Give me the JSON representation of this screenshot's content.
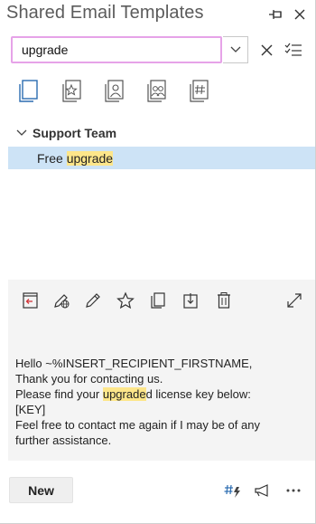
{
  "app": {
    "title": "Shared Email Templates"
  },
  "header": {
    "pin_icon": "pin-icon",
    "close_icon": "close-icon"
  },
  "search": {
    "value": "upgrade",
    "placeholder": ""
  },
  "tabs": [
    {
      "name": "templates",
      "icon": "template-icon",
      "active": true
    },
    {
      "name": "favorites",
      "icon": "star-page-icon"
    },
    {
      "name": "my-templates",
      "icon": "user-page-icon"
    },
    {
      "name": "shared",
      "icon": "users-page-icon"
    },
    {
      "name": "macros",
      "icon": "hash-page-icon"
    }
  ],
  "tree": {
    "group": {
      "label": "Support Team",
      "expanded": true
    },
    "item": {
      "label_before": "Free ",
      "label_match": "upgrade",
      "label_after": ""
    }
  },
  "preview": {
    "toolbar": [
      "insert-icon",
      "edit-globe-icon",
      "edit-icon",
      "star-icon",
      "copy-icon",
      "move-icon",
      "delete-icon",
      "expand-icon"
    ],
    "lines": [
      "Hello ~%INSERT_RECIPIENT_FIRSTNAME,",
      "Thank you for contacting us."
    ],
    "line3": {
      "before": "Please find your ",
      "match": "upgrade",
      "after": "d license key below:"
    },
    "lines_after": [
      "[KEY]",
      "Feel free to contact me again if I may be of any",
      "further assistance."
    ]
  },
  "footer": {
    "new_label": "New",
    "icons": [
      "macro-icon",
      "announce-icon",
      "more-icon"
    ]
  },
  "colors": {
    "search_border": "#e6a3e8",
    "selection": "#cde3f6",
    "highlight": "#fde68a",
    "accent": "#2b6cb0",
    "red": "#d13438"
  }
}
